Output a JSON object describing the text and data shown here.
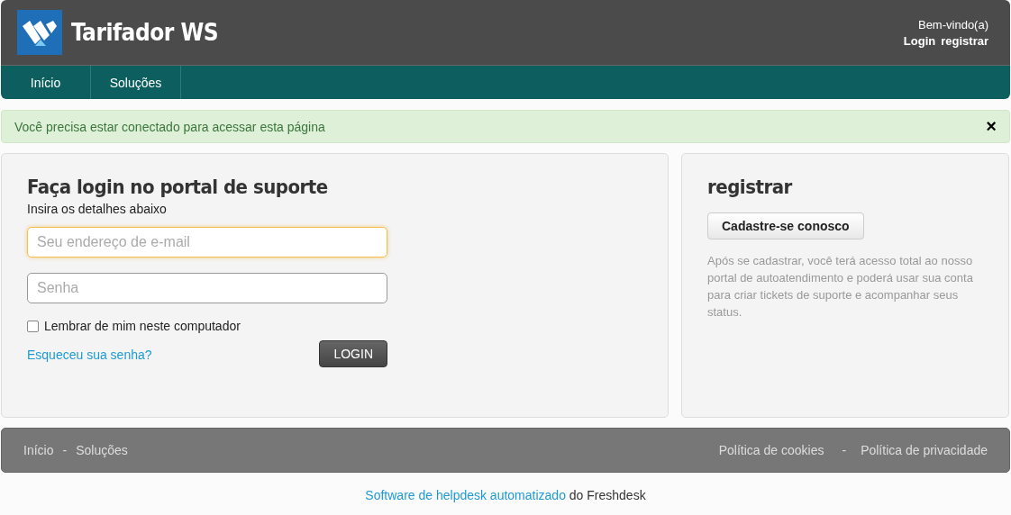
{
  "header": {
    "title": "Tarifador WS",
    "welcome": "Bem-vindo(a)",
    "links": [
      "Login",
      "registrar"
    ]
  },
  "nav": {
    "items": [
      {
        "label": "Início",
        "selected": false
      },
      {
        "label": "Soluções",
        "selected": false
      }
    ]
  },
  "alert": {
    "message": "Você precisa estar conectado para acessar esta página",
    "close": "×"
  },
  "login": {
    "title": "Faça login no portal de suporte",
    "subtitle": "Insira os detalhes abaixo",
    "fields": [
      {
        "placeholder": "Seu endereço de e-mail",
        "focused": true
      },
      {
        "placeholder": "Senha",
        "focused": false
      }
    ],
    "remember": {
      "label": "Lembrar de mim neste computador",
      "checked": false
    },
    "forgot": "Esqueceu sua senha?",
    "button": "LOGIN"
  },
  "register": {
    "title": "registrar",
    "button": "Cadastre-se conosco",
    "description": "Após se cadastrar, você terá acesso total ao nosso portal de autoatendimento e poderá usar sua conta para criar tickets de suporte e acompanhar seus status."
  },
  "footer": {
    "left": {
      "links": [
        "Início",
        "Soluções"
      ],
      "separator": "-"
    },
    "right": {
      "links": [
        "Política de cookies",
        "Política de privacidade"
      ],
      "separator": "-"
    }
  },
  "credit": {
    "link": "Software de helpdesk automatizado",
    "rest": "do Freshdesk"
  }
}
